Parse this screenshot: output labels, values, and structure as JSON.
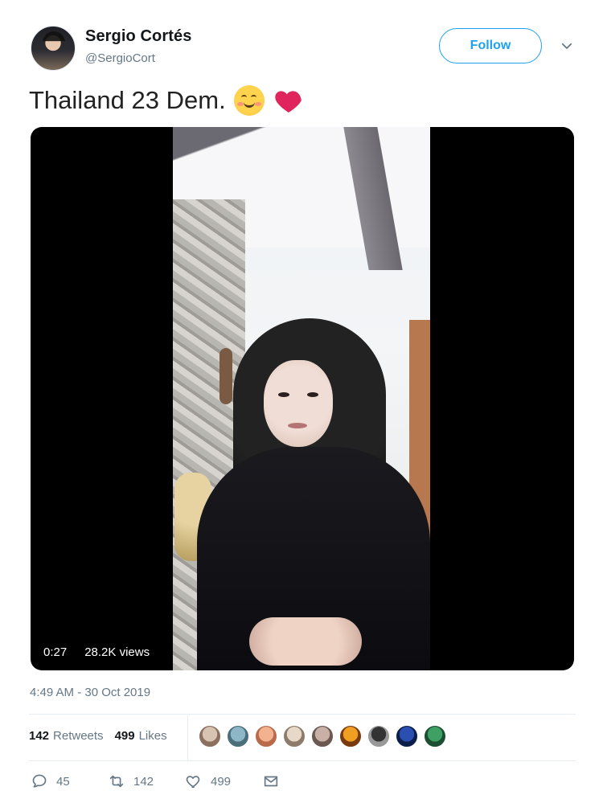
{
  "user": {
    "name": "Sergio Cortés",
    "handle": "@SergioCort"
  },
  "follow_button": "Follow",
  "tweet": {
    "text": "Thailand 23 Dem.",
    "emojis": [
      "smiling-face-icon",
      "red-heart-icon"
    ]
  },
  "video": {
    "duration": "0:27",
    "views": "28.2K views"
  },
  "timestamp": "4:49 AM - 30 Oct 2019",
  "stats": {
    "retweets_count": "142",
    "retweets_label": "Retweets",
    "likes_count": "499",
    "likes_label": "Likes"
  },
  "liker_avatars": [
    {
      "color_a": "#d7c3b2",
      "color_b": "#8b6f5f"
    },
    {
      "color_a": "#8db6c7",
      "color_b": "#4a6f7b"
    },
    {
      "color_a": "#f2b28f",
      "color_b": "#b86b4b"
    },
    {
      "color_a": "#e7d9c8",
      "color_b": "#8f7b6a"
    },
    {
      "color_a": "#c8b0a6",
      "color_b": "#6b5850"
    },
    {
      "color_a": "#f0a020",
      "color_b": "#7a3a10"
    },
    {
      "color_a": "#333333",
      "color_b": "#999999"
    },
    {
      "color_a": "#2a4fb0",
      "color_b": "#0b1e4a"
    },
    {
      "color_a": "#3fa064",
      "color_b": "#1c4f31"
    }
  ],
  "actions": {
    "replies": "45",
    "retweets": "142",
    "likes": "499"
  },
  "colors": {
    "accent": "#1da1f2",
    "secondary_text": "#657786",
    "heart": "#e0245e"
  }
}
